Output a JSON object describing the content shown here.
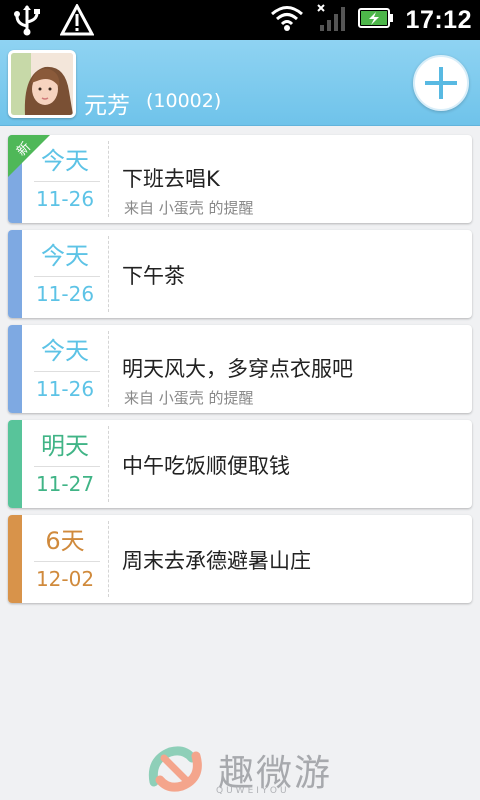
{
  "status_bar": {
    "time": "17:12",
    "icons": [
      "usb-icon",
      "warning-icon",
      "wifi-icon",
      "signal-icon",
      "battery-charging-icon"
    ]
  },
  "header": {
    "user_name": "元芳",
    "user_id": "(10002)",
    "add_icon": "plus-icon"
  },
  "reminders": [
    {
      "day": "今天",
      "date": "11-26",
      "title": "下班去唱K",
      "sub": "来自 小蛋壳 的提醒",
      "badge": "新",
      "color": "#7ea9e2",
      "text_color": "#5dc3e6"
    },
    {
      "day": "今天",
      "date": "11-26",
      "title": "下午茶",
      "sub": "",
      "badge": "",
      "color": "#7ea9e2",
      "text_color": "#5dc3e6"
    },
    {
      "day": "今天",
      "date": "11-26",
      "title": "明天风大，多穿点衣服吧",
      "sub": "来自 小蛋壳 的提醒",
      "badge": "",
      "color": "#7ea9e2",
      "text_color": "#5dc3e6"
    },
    {
      "day": "明天",
      "date": "11-27",
      "title": "中午吃饭顺便取钱",
      "sub": "",
      "badge": "",
      "color": "#58c49a",
      "text_color": "#40b486"
    },
    {
      "day": "6天",
      "date": "12-02",
      "title": "周末去承德避暑山庄",
      "sub": "",
      "badge": "",
      "color": "#d8934a",
      "text_color": "#d08a3c"
    }
  ],
  "watermark": {
    "text": "趣微游",
    "sub": "QUWEIYOU"
  }
}
